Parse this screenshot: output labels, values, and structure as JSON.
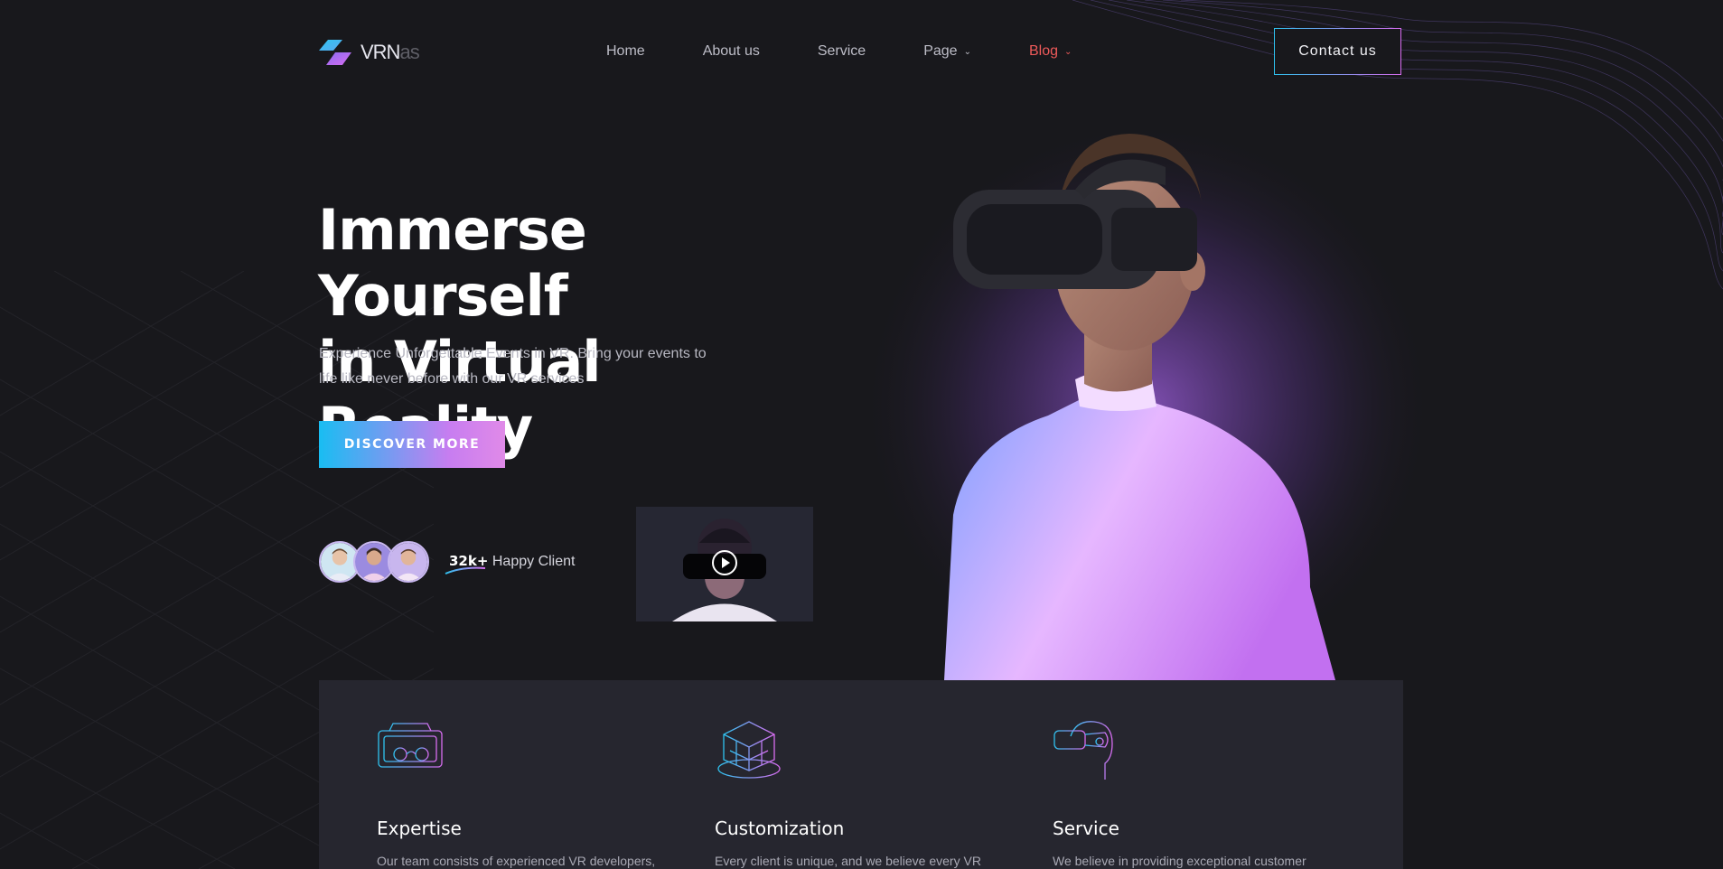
{
  "brand": {
    "logo_main": "VRN",
    "logo_fade": "as",
    "accent_cyan": "#19bdf2",
    "accent_purple": "#d86cf0",
    "active_color": "#ee5a5a"
  },
  "nav": {
    "items": [
      {
        "label": "Home"
      },
      {
        "label": "About us"
      },
      {
        "label": "Service"
      },
      {
        "label": "Page",
        "has_dropdown": true
      },
      {
        "label": "Blog",
        "has_dropdown": true,
        "active": true
      }
    ],
    "contact_label": "Contact us"
  },
  "hero": {
    "title_line1": "Immerse Yourself",
    "title_line2": "in Virtual Reality",
    "subtitle_line1": "Experience Unforgettable Events in VR. Bring your events to",
    "subtitle_line2": "life like never before with our VR services",
    "cta_label": "DISCOVER MORE",
    "clients_count": "32k+",
    "clients_label": "Happy Client"
  },
  "features": [
    {
      "icon": "vr-headset-icon",
      "title": "Expertise",
      "text": "Our team consists of experienced VR developers,"
    },
    {
      "icon": "3d-cube-icon",
      "title": "Customization",
      "text": "Every client is unique, and we believe every VR"
    },
    {
      "icon": "vr-head-profile-icon",
      "title": "Service",
      "text": "We believe in providing exceptional customer"
    }
  ]
}
